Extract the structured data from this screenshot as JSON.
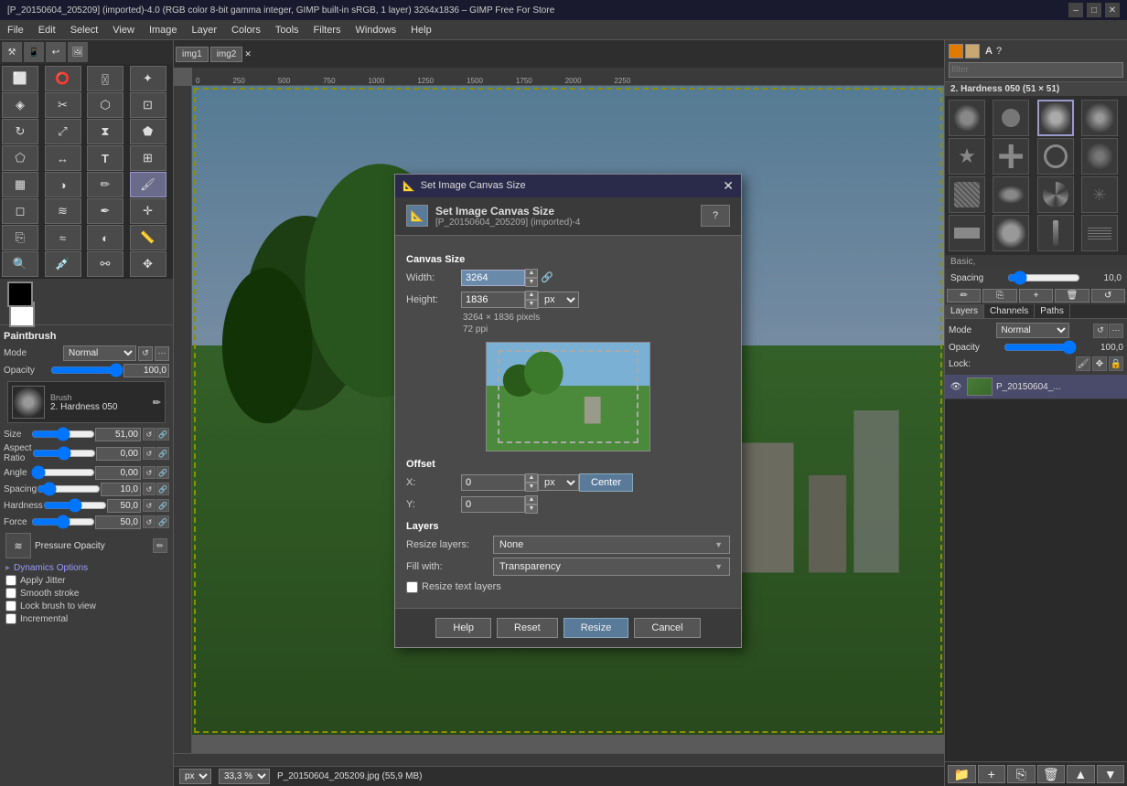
{
  "titlebar": {
    "title": "[P_20150604_205209] (imported)-4.0 (RGB color 8-bit gamma integer, GIMP built-in sRGB, 1 layer) 3264x1836 – GIMP Free For Store",
    "minimize": "–",
    "maximize": "□",
    "close": "✕"
  },
  "menubar": {
    "items": [
      "File",
      "Edit",
      "Select",
      "View",
      "Image",
      "Layer",
      "Colors",
      "Tools",
      "Filters",
      "Windows",
      "Help"
    ]
  },
  "imagetabs": [
    {
      "label": "img1",
      "active": false
    },
    {
      "label": "img2",
      "active": false
    },
    {
      "label": "×",
      "close": true
    }
  ],
  "toolbox": {
    "tools": [
      {
        "name": "rect-select",
        "icon": "⬜"
      },
      {
        "name": "ellipse-select",
        "icon": "⭕"
      },
      {
        "name": "lasso-select",
        "icon": "⚯"
      },
      {
        "name": "fuzzy-select",
        "icon": "✦"
      },
      {
        "name": "select-by-color",
        "icon": "◈"
      },
      {
        "name": "scissors",
        "icon": "✂"
      },
      {
        "name": "foreground-select",
        "icon": "⬡"
      },
      {
        "name": "crop",
        "icon": "⊡"
      },
      {
        "name": "rotate",
        "icon": "↻"
      },
      {
        "name": "scale",
        "icon": "⤢"
      },
      {
        "name": "shear",
        "icon": "⧗"
      },
      {
        "name": "perspective",
        "icon": "⬟"
      },
      {
        "name": "transform",
        "icon": "⬠"
      },
      {
        "name": "flip",
        "icon": "↔"
      },
      {
        "name": "text",
        "icon": "T"
      },
      {
        "name": "align",
        "icon": "⊞"
      },
      {
        "name": "bucket-fill",
        "icon": "🪣"
      },
      {
        "name": "blend",
        "icon": "◑"
      },
      {
        "name": "pencil",
        "icon": "✏"
      },
      {
        "name": "paintbrush",
        "icon": "🖌"
      },
      {
        "name": "eraser",
        "icon": "⬜"
      },
      {
        "name": "airbrush",
        "icon": "💨"
      },
      {
        "name": "ink",
        "icon": "✒"
      },
      {
        "name": "heal",
        "icon": "✛"
      },
      {
        "name": "clone",
        "icon": "⎘"
      },
      {
        "name": "smudge",
        "icon": "≈"
      },
      {
        "name": "dodge-burn",
        "icon": "◐"
      },
      {
        "name": "measure",
        "icon": "📏"
      },
      {
        "name": "zoom",
        "icon": "🔍"
      },
      {
        "name": "color-picker",
        "icon": "💉"
      },
      {
        "name": "paths",
        "icon": "✒"
      },
      {
        "name": "move",
        "icon": "✥"
      }
    ]
  },
  "tool_options": {
    "title": "Paintbrush",
    "mode_label": "Mode",
    "mode_value": "Normal",
    "opacity_label": "Opacity",
    "opacity_value": "100,0",
    "brush_label": "Brush",
    "brush_name": "2. Hardness 050",
    "size_label": "Size",
    "size_value": "51,00",
    "aspect_label": "Aspect Ratio",
    "aspect_value": "0,00",
    "angle_label": "Angle",
    "angle_value": "0,00",
    "spacing_label": "Spacing",
    "spacing_value": "10,0",
    "hardness_label": "Hardness",
    "hardness_value": "50,0",
    "force_label": "Force",
    "force_value": "50,0",
    "dynamics_label": "Dynamics",
    "dynamics_value": "Pressure Opacity",
    "dynamics_options": "Dynamics Options",
    "apply_jitter": "Apply Jitter",
    "smooth_stroke": "Smooth stroke",
    "lock_brush": "Lock brush to view",
    "incremental": "Incremental"
  },
  "brushes_panel": {
    "title": "2. Hardness 050 (51 × 51)",
    "filter_placeholder": "filter",
    "section": "Basic,",
    "spacing_label": "Spacing",
    "spacing_value": "10,0"
  },
  "layers_panel": {
    "tabs": [
      "Layers",
      "Channels",
      "Paths"
    ],
    "mode_label": "Mode",
    "mode_value": "Normal",
    "opacity_label": "Opacity",
    "opacity_value": "100,0",
    "lock_label": "Lock:",
    "layers": [
      {
        "name": "P_20150604_...",
        "visible": true,
        "active": true
      }
    ]
  },
  "dialog": {
    "title": "Set Image Canvas Size",
    "header_title": "Set Image Canvas Size",
    "header_sub": "[P_20150604_205209] (imported)-4",
    "canvas_size_title": "Canvas Size",
    "width_label": "Width:",
    "width_value": "3264",
    "height_label": "Height:",
    "height_value": "1836",
    "info_pixels": "3264 × 1836 pixels",
    "info_ppi": "72 ppi",
    "offset_title": "Offset",
    "x_label": "X:",
    "x_value": "0",
    "y_label": "Y:",
    "y_value": "0",
    "unit": "px",
    "center_btn": "Center",
    "layers_title": "Layers",
    "resize_layers_label": "Resize layers:",
    "resize_layers_value": "None",
    "fill_with_label": "Fill with:",
    "fill_with_value": "Transparency",
    "resize_text_layers": "Resize text layers",
    "help_btn": "Help",
    "reset_btn": "Reset",
    "resize_btn": "Resize",
    "cancel_btn": "Cancel"
  },
  "statusbar": {
    "unit": "px",
    "zoom": "33,3 %",
    "filename": "P_20150604_205209.jpg (55,9 MB)"
  }
}
